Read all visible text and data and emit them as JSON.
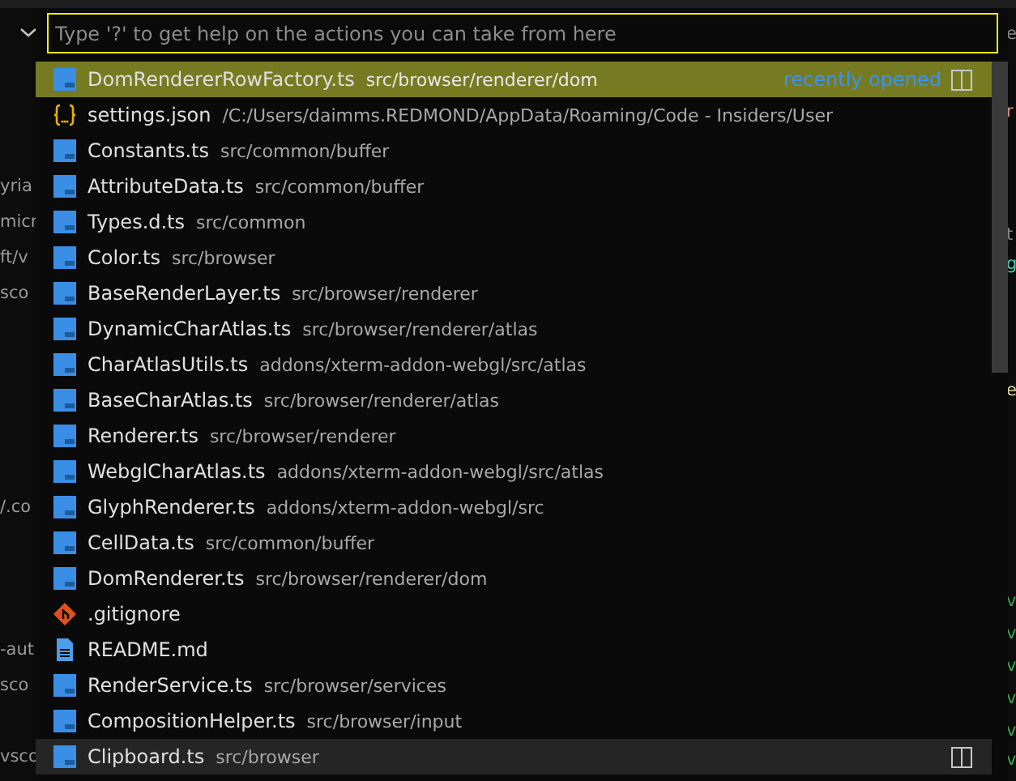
{
  "editor": {
    "left_fragments": [
      {
        "text": "yria"
      },
      {
        "text": "micr"
      },
      {
        "text": "ft/v"
      },
      {
        "text": "sco"
      },
      {
        "text": "/.co"
      },
      {
        "text": "-aut"
      },
      {
        "text": "sco"
      },
      {
        "text": "vsco"
      }
    ],
    "right_fragments": [
      {
        "text": "e",
        "color": "#8a8a8a"
      },
      {
        "text": "r",
        "color": "#ce9178"
      },
      {
        "text": "t",
        "color": "#8a8a8a"
      },
      {
        "text": "g",
        "color": "#4ec9b0"
      },
      {
        "text": "e",
        "color": "#dcdcaa"
      },
      {
        "text": "v",
        "color": "#3fa34d"
      },
      {
        "text": "v",
        "color": "#3fa34d"
      },
      {
        "text": "v",
        "color": "#3fa34d"
      },
      {
        "text": "v",
        "color": "#3fa34d"
      },
      {
        "text": "v",
        "color": "#3fa34d"
      },
      {
        "text": "v",
        "color": "#3fa34d"
      }
    ]
  },
  "quick_pick": {
    "input": {
      "placeholder": "Type '?' to get help on the actions you can take from here"
    },
    "items": [
      {
        "kind": "ts",
        "label": "DomRendererRowFactory.ts",
        "description": "src/browser/renderer/dom",
        "detail": "recently opened",
        "selected": true,
        "hovered": false
      },
      {
        "kind": "json",
        "label": "settings.json",
        "description": "/C:/Users/daimms.REDMOND/AppData/Roaming/Code - Insiders/User",
        "selected": false,
        "hovered": false
      },
      {
        "kind": "ts",
        "label": "Constants.ts",
        "description": "src/common/buffer",
        "selected": false,
        "hovered": false
      },
      {
        "kind": "ts",
        "label": "AttributeData.ts",
        "description": "src/common/buffer",
        "selected": false,
        "hovered": false
      },
      {
        "kind": "ts",
        "label": "Types.d.ts",
        "description": "src/common",
        "selected": false,
        "hovered": false
      },
      {
        "kind": "ts",
        "label": "Color.ts",
        "description": "src/browser",
        "selected": false,
        "hovered": false
      },
      {
        "kind": "ts",
        "label": "BaseRenderLayer.ts",
        "description": "src/browser/renderer",
        "selected": false,
        "hovered": false
      },
      {
        "kind": "ts",
        "label": "DynamicCharAtlas.ts",
        "description": "src/browser/renderer/atlas",
        "selected": false,
        "hovered": false
      },
      {
        "kind": "ts",
        "label": "CharAtlasUtils.ts",
        "description": "addons/xterm-addon-webgl/src/atlas",
        "selected": false,
        "hovered": false
      },
      {
        "kind": "ts",
        "label": "BaseCharAtlas.ts",
        "description": "src/browser/renderer/atlas",
        "selected": false,
        "hovered": false
      },
      {
        "kind": "ts",
        "label": "Renderer.ts",
        "description": "src/browser/renderer",
        "selected": false,
        "hovered": false
      },
      {
        "kind": "ts",
        "label": "WebglCharAtlas.ts",
        "description": "addons/xterm-addon-webgl/src/atlas",
        "selected": false,
        "hovered": false
      },
      {
        "kind": "ts",
        "label": "GlyphRenderer.ts",
        "description": "addons/xterm-addon-webgl/src",
        "selected": false,
        "hovered": false
      },
      {
        "kind": "ts",
        "label": "CellData.ts",
        "description": "src/common/buffer",
        "selected": false,
        "hovered": false
      },
      {
        "kind": "ts",
        "label": "DomRenderer.ts",
        "description": "src/browser/renderer/dom",
        "selected": false,
        "hovered": false
      },
      {
        "kind": "git",
        "label": ".gitignore",
        "selected": false,
        "hovered": false
      },
      {
        "kind": "md",
        "label": "README.md",
        "selected": false,
        "hovered": false
      },
      {
        "kind": "ts",
        "label": "RenderService.ts",
        "description": "src/browser/services",
        "selected": false,
        "hovered": false
      },
      {
        "kind": "ts",
        "label": "CompositionHelper.ts",
        "description": "src/browser/input",
        "selected": false,
        "hovered": false
      },
      {
        "kind": "ts",
        "label": "Clipboard.ts",
        "description": "src/browser",
        "selected": false,
        "hovered": true
      }
    ]
  }
}
